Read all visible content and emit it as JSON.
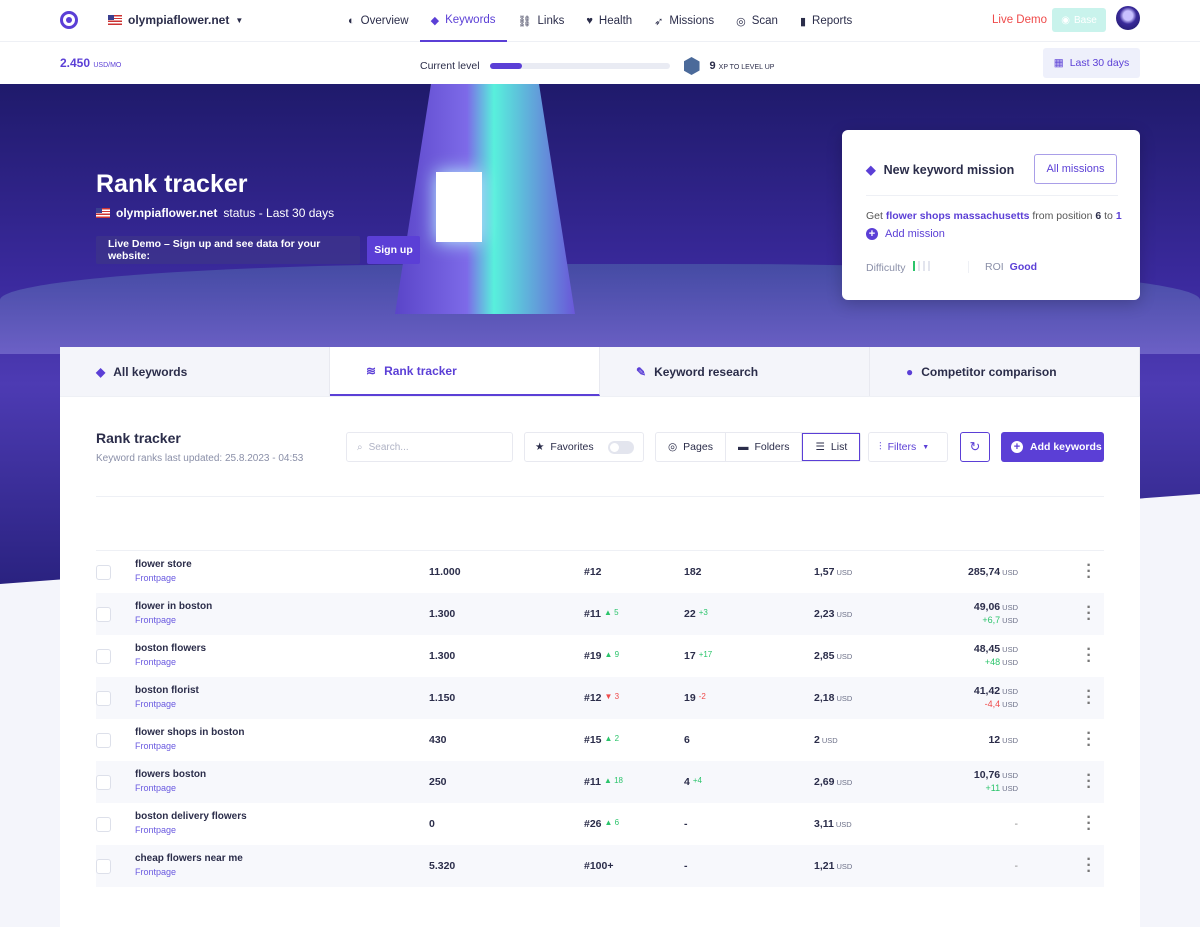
{
  "nav": {
    "site": "olympiaflower.net",
    "items": [
      {
        "label": "Overview",
        "icon": "planet-icon",
        "ic": "◐"
      },
      {
        "label": "Keywords",
        "icon": "tag-icon",
        "ic": "◆",
        "active": true
      },
      {
        "label": "Links",
        "icon": "link-icon",
        "ic": "⛓"
      },
      {
        "label": "Health",
        "icon": "heart-icon",
        "ic": "♥"
      },
      {
        "label": "Missions",
        "icon": "rocket-icon",
        "ic": "➶"
      },
      {
        "label": "Scan",
        "icon": "globe-icon",
        "ic": "◎"
      },
      {
        "label": "Reports",
        "icon": "document-icon",
        "ic": "▮"
      }
    ],
    "live_demo": "Live Demo",
    "base": "Base"
  },
  "subbar": {
    "price": "2.450",
    "price_unit": "USD/MO",
    "level_label": "Current level",
    "level_progress": 0.18,
    "xp": "9",
    "xp_label": "XP TO LEVEL UP",
    "dates": "Last 30 days"
  },
  "hero": {
    "title": "Rank tracker",
    "site": "olympiaflower.net",
    "status": "status - Last 30 days",
    "demo_text": "Live Demo – Sign up and see data for your website:",
    "signup": "Sign up"
  },
  "mission": {
    "title": "New keyword mission",
    "all": "All missions",
    "get": "Get",
    "keyword": "flower shops massachusetts",
    "from": "from position",
    "pos_from": "6",
    "to": "to",
    "pos_to": "1",
    "add": "Add mission",
    "difficulty": "Difficulty",
    "difficulty_level": 1,
    "roi_label": "ROI",
    "roi": "Good"
  },
  "tabs": [
    {
      "label": "All keywords",
      "icon": "tag-icon",
      "ic": "◆"
    },
    {
      "label": "Rank tracker",
      "icon": "layers-icon",
      "ic": "≋",
      "active": true
    },
    {
      "label": "Keyword research",
      "icon": "telescope-icon",
      "ic": "✎"
    },
    {
      "label": "Competitor comparison",
      "icon": "alien-icon",
      "ic": "●"
    }
  ],
  "content": {
    "title": "Rank tracker",
    "updated": "Keyword ranks last updated: 25.8.2023 - 04:53",
    "search_placeholder": "Search...",
    "favorites": "Favorites",
    "pages": "Pages",
    "folders": "Folders",
    "list": "List",
    "filters": "Filters",
    "add": "Add keywords"
  },
  "colors": {
    "accent": "#5b3fd6",
    "up": "#2bc46b",
    "down": "#ef4a4a"
  },
  "rows": [
    {
      "kw": "flower store",
      "page": "Frontpage",
      "vol": "11.000",
      "rank": "#12",
      "rchg": "",
      "rdir": "",
      "vis": "182",
      "vchg": "",
      "vdir": "",
      "cpc": "1,57",
      "val": "285,74",
      "vd": "",
      "vddir": ""
    },
    {
      "kw": "flower in boston",
      "page": "Frontpage",
      "vol": "1.300",
      "rank": "#11",
      "rchg": "▲ 5",
      "rdir": "up",
      "vis": "22",
      "vchg": "+3",
      "vdir": "up",
      "cpc": "2,23",
      "val": "49,06",
      "vd": "+6,7",
      "vddir": "up"
    },
    {
      "kw": "boston flowers",
      "page": "Frontpage",
      "vol": "1.300",
      "rank": "#19",
      "rchg": "▲ 9",
      "rdir": "up",
      "vis": "17",
      "vchg": "+17",
      "vdir": "up",
      "cpc": "2,85",
      "val": "48,45",
      "vd": "+48",
      "vddir": "up"
    },
    {
      "kw": "boston florist",
      "page": "Frontpage",
      "vol": "1.150",
      "rank": "#12",
      "rchg": "▼ 3",
      "rdir": "dn",
      "vis": "19",
      "vchg": "-2",
      "vdir": "dn",
      "cpc": "2,18",
      "val": "41,42",
      "vd": "-4,4",
      "vddir": "dn"
    },
    {
      "kw": "flower shops in boston",
      "page": "Frontpage",
      "vol": "430",
      "rank": "#15",
      "rchg": "▲ 2",
      "rdir": "up",
      "vis": "6",
      "vchg": "",
      "vdir": "",
      "cpc": "2",
      "val": "12",
      "vd": "",
      "vddir": ""
    },
    {
      "kw": "flowers boston",
      "page": "Frontpage",
      "vol": "250",
      "rank": "#11",
      "rchg": "▲ 18",
      "rdir": "up",
      "vis": "4",
      "vchg": "+4",
      "vdir": "up",
      "cpc": "2,69",
      "val": "10,76",
      "vd": "+11",
      "vddir": "up"
    },
    {
      "kw": "boston delivery flowers",
      "page": "Frontpage",
      "vol": "0",
      "rank": "#26",
      "rchg": "▲ 6",
      "rdir": "up",
      "vis": "-",
      "vchg": "",
      "vdir": "",
      "cpc": "3,11",
      "val": "-",
      "vd": "",
      "vddir": ""
    },
    {
      "kw": "cheap flowers near me",
      "page": "Frontpage",
      "vol": "5.320",
      "rank": "#100+",
      "rchg": "",
      "rdir": "",
      "vis": "-",
      "vchg": "",
      "vdir": "",
      "cpc": "1,21",
      "val": "-",
      "vd": "",
      "vddir": ""
    }
  ],
  "currency": "USD"
}
